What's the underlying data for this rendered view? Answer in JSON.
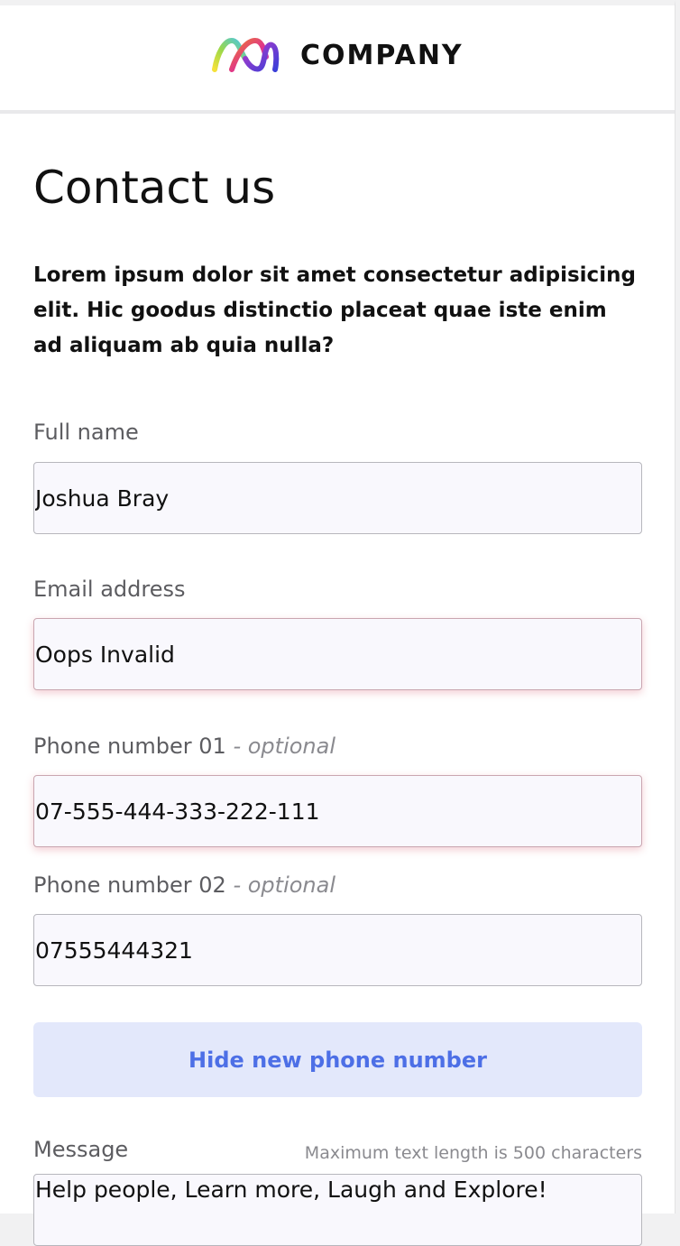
{
  "header": {
    "brand_name": "COMPANY",
    "logo_icon": "ribbon-m-logo-icon",
    "logo_colors": [
      "#f5e13a",
      "#48c6e8",
      "#ee7d2a",
      "#b43ac9",
      "#3b3fd8"
    ]
  },
  "page": {
    "title": "Contact us",
    "intro": "Lorem ipsum dolor sit amet consectetur adipisicing elit. Hic goodus distinctio placeat quae iste enim ad aliquam ab quia nulla?"
  },
  "form": {
    "full_name": {
      "label": "Full name",
      "value": "Joshua Bray"
    },
    "email": {
      "label": "Email address",
      "value": "Oops Invalid",
      "state": "invalid"
    },
    "phone_1": {
      "label": "Phone number 01",
      "optional_label": "- optional",
      "value": "07-555-444-333-222-111",
      "state": "invalid"
    },
    "phone_2": {
      "label": "Phone number 02",
      "optional_label": "- optional",
      "value": "07555444321"
    },
    "hide_phone_button": {
      "label": "Hide new phone number"
    },
    "message": {
      "label": "Message",
      "hint": "Maximum text length is 500 characters",
      "value": "Help people, Learn more, Laugh and Explore!"
    }
  },
  "colors": {
    "accent": "#4d6fe6",
    "accent_bg": "#e3e8fb",
    "invalid_glow": "#d65a6e",
    "input_bg": "#f9f8fd"
  }
}
